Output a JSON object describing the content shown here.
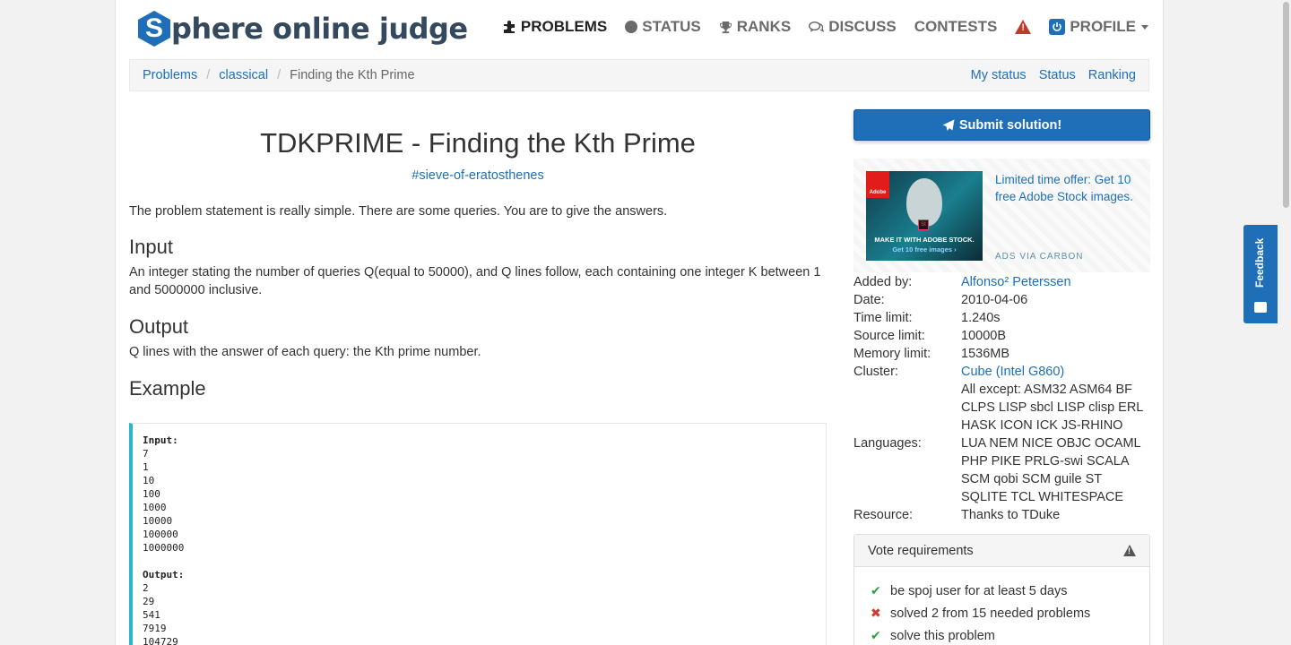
{
  "header": {
    "logo_letter": "S",
    "logo_text": "phere online judge",
    "nav": [
      {
        "label": "PROBLEMS",
        "icon": "puzzle-icon"
      },
      {
        "label": "STATUS",
        "icon": "circle-icon"
      },
      {
        "label": "RANKS",
        "icon": "trophy-icon"
      },
      {
        "label": "DISCUSS",
        "icon": "comments-icon"
      },
      {
        "label": "CONTESTS",
        "icon": ""
      }
    ],
    "profile_label": "PROFILE"
  },
  "breadcrumb": {
    "items": [
      "Problems",
      "classical",
      "Finding the Kth Prime"
    ],
    "right_links": [
      "My status",
      "Status",
      "Ranking"
    ]
  },
  "problem": {
    "title": "TDKPRIME - Finding the Kth Prime",
    "tag": "#sieve-of-eratosthenes",
    "statement": "The problem statement is really simple. There are some queries. You are to give the answers.",
    "input_heading": "Input",
    "input_text": "An integer stating the number of queries Q(equal to 50000), and Q lines follow, each containing one integer K between 1 and 5000000 inclusive.",
    "output_heading": "Output",
    "output_text": "Q lines with the answer of each query: the Kth prime number.",
    "example_heading": "Example",
    "example": {
      "input_label": "Input:",
      "input_lines": [
        "7",
        "1",
        "10",
        "100",
        "1000",
        "10000",
        "100000",
        "1000000"
      ],
      "output_label": "Output:",
      "output_lines": [
        "2",
        "29",
        "541",
        "7919",
        "104729"
      ]
    }
  },
  "sidebar": {
    "submit_label": "Submit solution!",
    "ad": {
      "brand": "Adobe",
      "image_caption": "MAKE IT WITH ADOBE STOCK.",
      "image_cta": "Get 10 free images ›",
      "product_mark": "St",
      "text": "Limited time offer: Get 10 free Adobe Stock images.",
      "via": "ADS VIA CARBON"
    },
    "info": {
      "added_by_label": "Added by:",
      "added_by": "Alfonso² Peterssen",
      "date_label": "Date:",
      "date": "2010-04-06",
      "time_limit_label": "Time limit:",
      "time_limit": "1.240s",
      "source_limit_label": "Source limit:",
      "source_limit": "10000B",
      "memory_limit_label": "Memory limit:",
      "memory_limit": "1536MB",
      "cluster_label": "Cluster:",
      "cluster": "Cube (Intel G860)",
      "languages_label": "Languages:",
      "languages": "All except: ASM32 ASM64 BF CLPS LISP sbcl LISP clisp ERL HASK ICON ICK JS-RHINO LUA NEM NICE OBJC OCAML PHP PIKE PRLG-swi SCALA SCM qobi SCM guile ST SQLITE TCL WHITESPACE",
      "resource_label": "Resource:",
      "resource": "Thanks to TDuke"
    },
    "vote": {
      "heading": "Vote requirements",
      "items": [
        {
          "text": "be spoj user for at least 5 days",
          "ok": true
        },
        {
          "text": "solved 2 from 15 needed problems",
          "ok": false
        },
        {
          "text": "solve this problem",
          "ok": true
        }
      ]
    }
  },
  "feedback_label": "Feedback",
  "colors": {
    "brand": "#1e6fb8",
    "accent_example": "#2ab7c9",
    "check": "#2e9e3a",
    "cross": "#d23a2f"
  }
}
